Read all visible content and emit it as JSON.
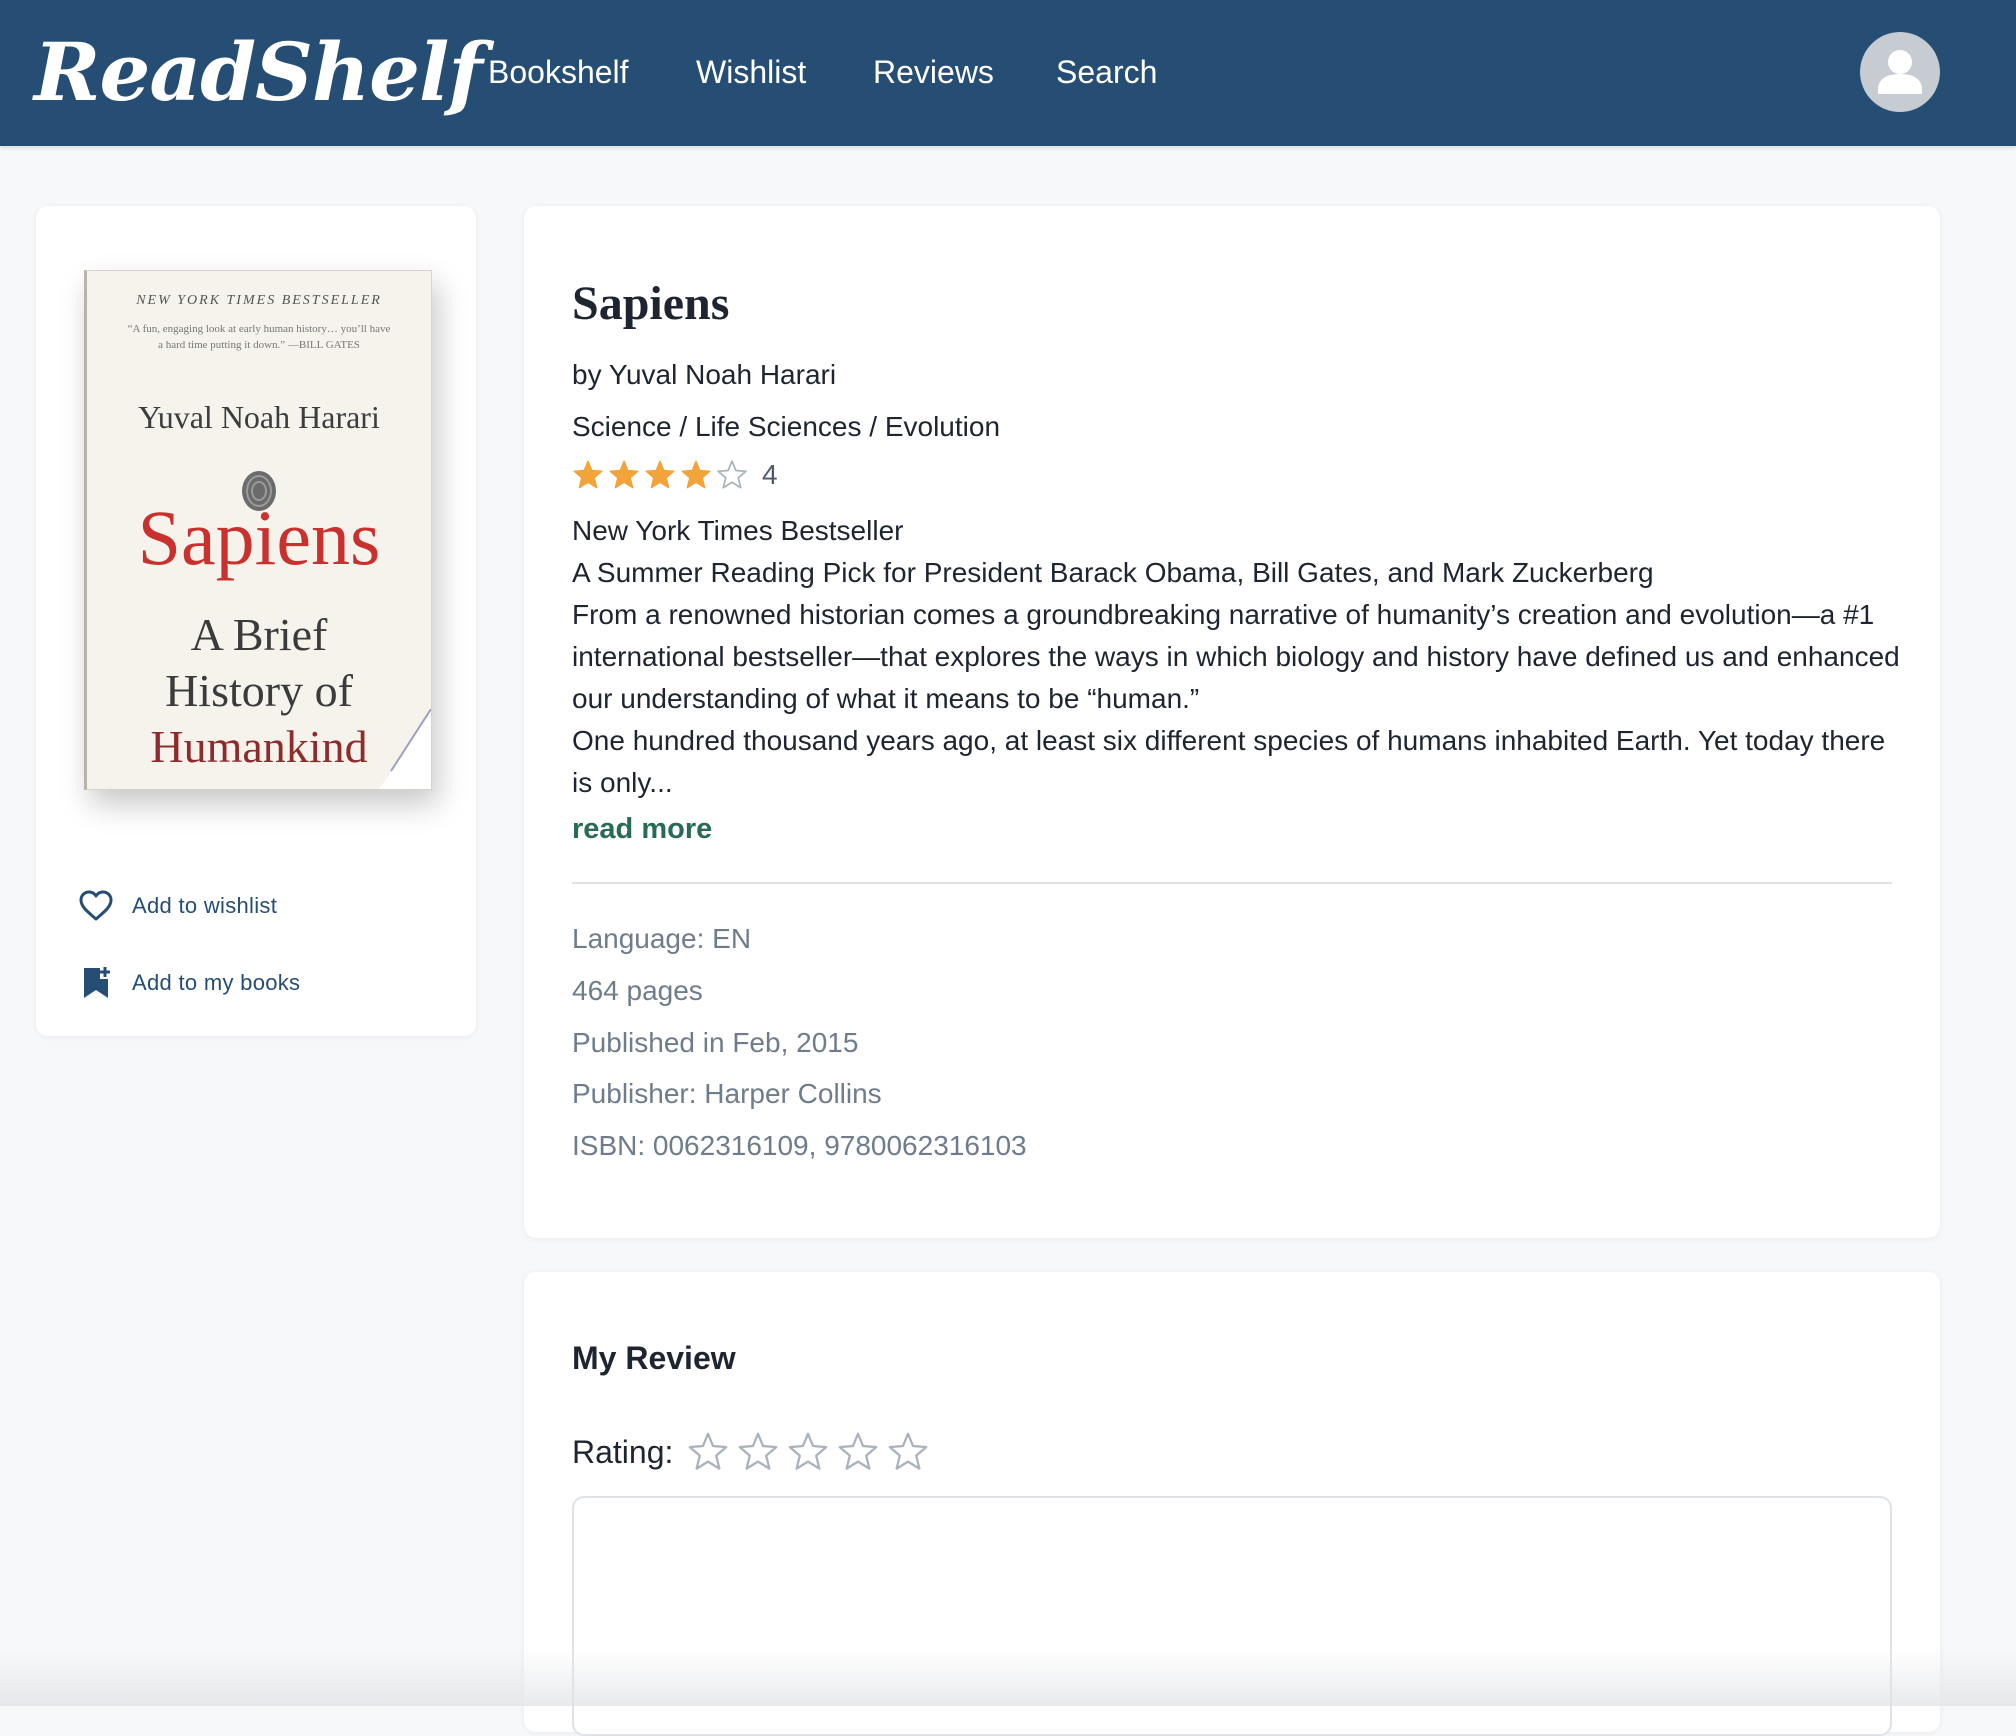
{
  "app": {
    "logo": "ReadShelf",
    "nav": [
      "Bookshelf",
      "Wishlist",
      "Reviews",
      "Search"
    ]
  },
  "colors": {
    "header_bg": "#264d73",
    "accent_link": "#2a6b55",
    "star_filled": "#f2a33a",
    "meta_text": "#6f7c8c"
  },
  "cover": {
    "banner": "NEW YORK TIMES BESTSELLER",
    "quote": "“A fun, engaging look at early human history… you’ll have a hard time putting it down.” —BILL GATES",
    "author": "Yuval Noah Harari",
    "title": "Sapiens",
    "subtitle_line1": "A Brief",
    "subtitle_line2": "History of",
    "subtitle_line3": "Humankind"
  },
  "actions": {
    "wishlist": {
      "label": "Add to wishlist",
      "icon": "heart-icon"
    },
    "my_books": {
      "label": "Add to my books",
      "icon": "bookmark-plus-icon"
    }
  },
  "book": {
    "title": "Sapiens",
    "author_line": "by Yuval Noah Harari",
    "categories": "Science / Life Sciences / Evolution",
    "rating": {
      "value": 4,
      "max": 5,
      "label": "4"
    },
    "description": [
      "New York Times Bestseller",
      "A Summer Reading Pick for President Barack Obama, Bill Gates, and Mark Zuckerberg",
      "From a renowned historian comes a groundbreaking narrative of humanity’s creation and evolution—a #1 international bestseller—that explores the ways in which biology and history have defined us and enhanced our understanding of what it means to be “human.”",
      "One hundred thousand years ago, at least six different species of humans inhabited Earth. Yet today there is only..."
    ],
    "read_more": "read more",
    "meta": {
      "language": "Language: EN",
      "pages": "464 pages",
      "published": "Published in Feb, 2015",
      "publisher": "Publisher: Harper Collins",
      "isbn": "ISBN: 0062316109, 9780062316103"
    }
  },
  "review": {
    "heading": "My Review",
    "rating_label": "Rating:",
    "rating_value": 0,
    "rating_max": 5,
    "text_value": ""
  }
}
